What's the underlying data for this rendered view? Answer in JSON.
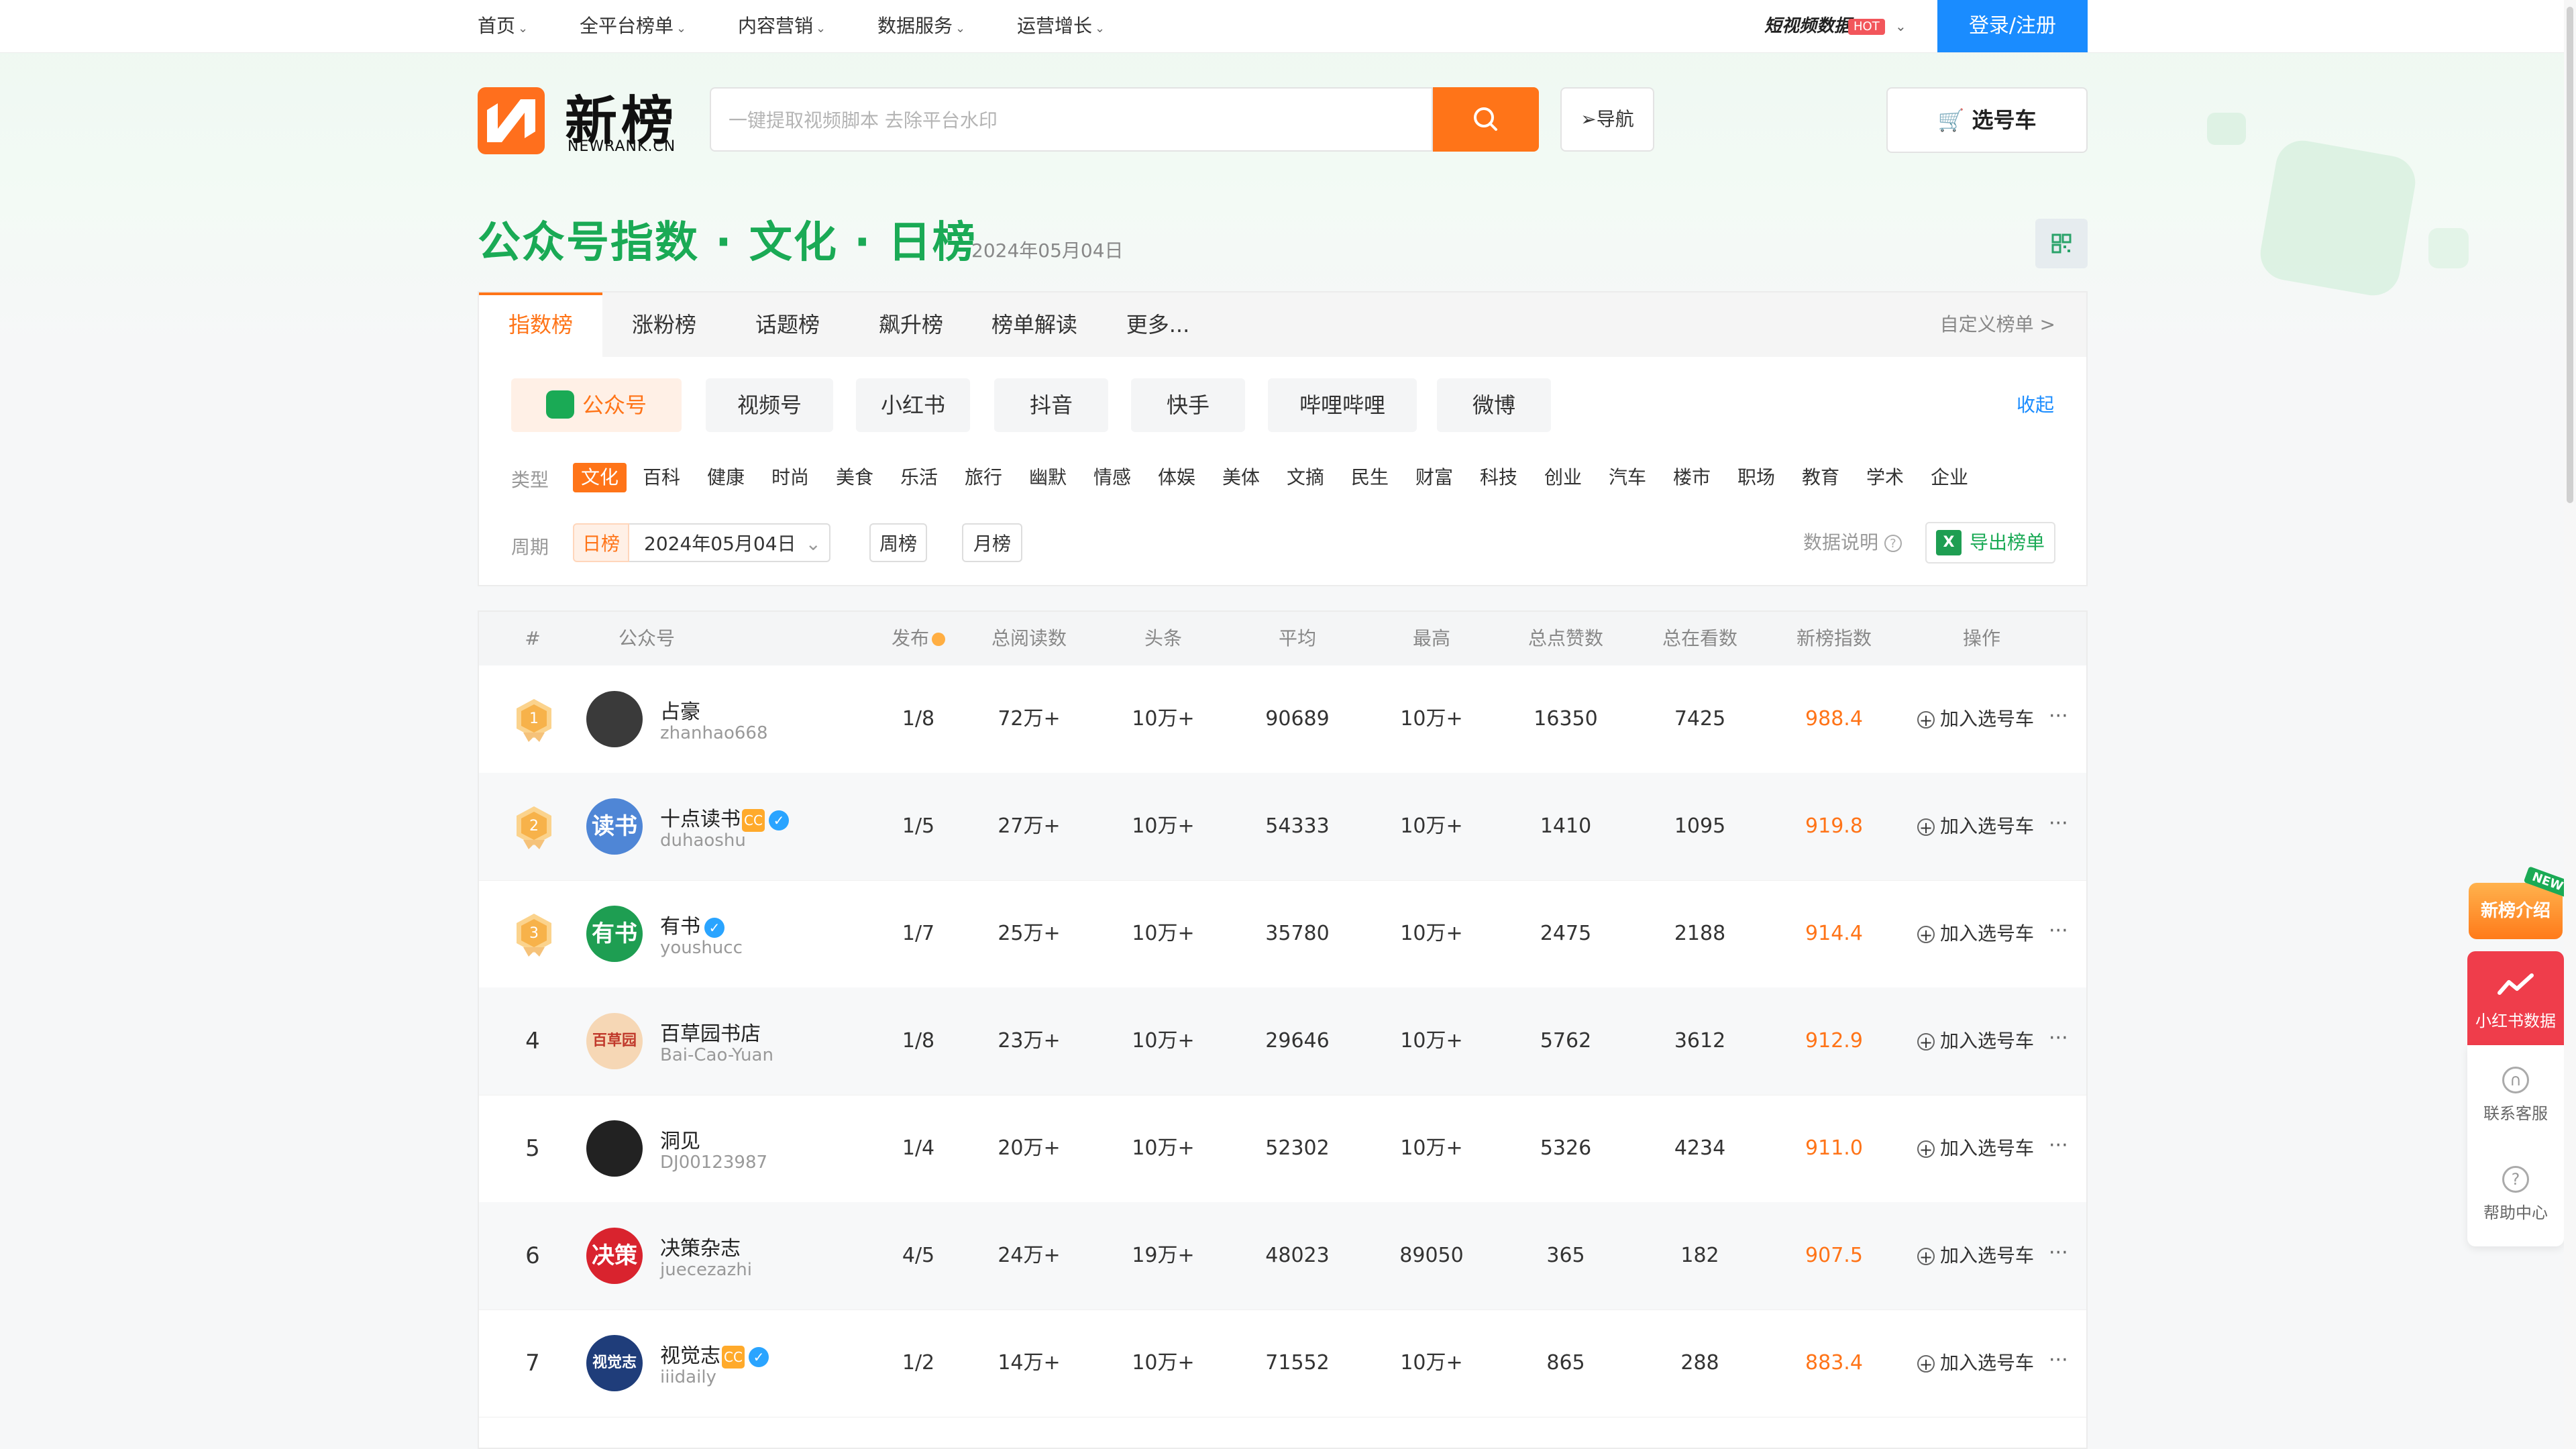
{
  "topnav": {
    "items": [
      {
        "label": "首页"
      },
      {
        "label": "全平台榜单"
      },
      {
        "label": "内容营销"
      },
      {
        "label": "数据服务"
      },
      {
        "label": "运营增长"
      }
    ],
    "video_data": "短视频数据",
    "hot_badge": "HOT",
    "login": "登录/注册"
  },
  "header": {
    "logo_text": "新榜",
    "logo_sub": "NEWRANK.CN",
    "search_placeholder": "一键提取视频脚本 去除平台水印",
    "nav_label": "导航",
    "cart_label": "选号车"
  },
  "title": {
    "main": "公众号指数 · 文化 · 日榜",
    "date": "2024年05月04日"
  },
  "tabs": [
    {
      "label": "指数榜",
      "active": true
    },
    {
      "label": "涨粉榜"
    },
    {
      "label": "话题榜"
    },
    {
      "label": "飙升榜"
    },
    {
      "label": "榜单解读"
    },
    {
      "label": "更多..."
    }
  ],
  "custom_list": "自定义榜单 >",
  "platforms": [
    {
      "label": "公众号",
      "active": true
    },
    {
      "label": "视频号"
    },
    {
      "label": "小红书"
    },
    {
      "label": "抖音"
    },
    {
      "label": "快手"
    },
    {
      "label": "哔哩哔哩"
    },
    {
      "label": "微博"
    }
  ],
  "collapse": "收起",
  "type_label": "类型",
  "categories": [
    "文化",
    "百科",
    "健康",
    "时尚",
    "美食",
    "乐活",
    "旅行",
    "幽默",
    "情感",
    "体娱",
    "美体",
    "文摘",
    "民生",
    "财富",
    "科技",
    "创业",
    "汽车",
    "楼市",
    "职场",
    "教育",
    "学术",
    "企业"
  ],
  "active_category": "文化",
  "period": {
    "label": "周期",
    "day": "日榜",
    "date_value": "2024年05月04日",
    "week": "周榜",
    "month": "月榜",
    "data_desc": "数据说明",
    "export": "导出榜单"
  },
  "table": {
    "headers": [
      "#",
      "公众号",
      "发布",
      "总阅读数",
      "头条",
      "平均",
      "最高",
      "总点赞数",
      "总在看数",
      "新榜指数",
      "操作"
    ],
    "rows": [
      {
        "rank": "1",
        "name": "占豪",
        "id": "zhanhao668",
        "pub": "1/8",
        "reads": "72万+",
        "top": "10万+",
        "avg": "90689",
        "max": "10万+",
        "likes": "16350",
        "watching": "7425",
        "index": "988.4",
        "cc": false,
        "verified": false,
        "avatar": "",
        "avatar_color": "#3a3a3a"
      },
      {
        "rank": "2",
        "name": "十点读书",
        "id": "duhaoshu",
        "pub": "1/5",
        "reads": "27万+",
        "top": "10万+",
        "avg": "54333",
        "max": "10万+",
        "likes": "1410",
        "watching": "1095",
        "index": "919.8",
        "cc": true,
        "verified": true,
        "avatar": "读书",
        "avatar_color": "#4f86d6"
      },
      {
        "rank": "3",
        "name": "有书",
        "id": "youshucc",
        "pub": "1/7",
        "reads": "25万+",
        "top": "10万+",
        "avg": "35780",
        "max": "10万+",
        "likes": "2475",
        "watching": "2188",
        "index": "914.4",
        "cc": false,
        "verified": true,
        "avatar": "有书",
        "avatar_color": "#1e9e52"
      },
      {
        "rank": "4",
        "name": "百草园书店",
        "id": "Bai-Cao-Yuan",
        "pub": "1/8",
        "reads": "23万+",
        "top": "10万+",
        "avg": "29646",
        "max": "10万+",
        "likes": "5762",
        "watching": "3612",
        "index": "912.9",
        "cc": false,
        "verified": false,
        "avatar": "百草园",
        "avatar_color": "#f6d7b5"
      },
      {
        "rank": "5",
        "name": "洞见",
        "id": "DJ00123987",
        "pub": "1/4",
        "reads": "20万+",
        "top": "10万+",
        "avg": "52302",
        "max": "10万+",
        "likes": "5326",
        "watching": "4234",
        "index": "911.0",
        "cc": false,
        "verified": false,
        "avatar": "",
        "avatar_color": "#222222"
      },
      {
        "rank": "6",
        "name": "决策杂志",
        "id": "juecezazhi",
        "pub": "4/5",
        "reads": "24万+",
        "top": "19万+",
        "avg": "48023",
        "max": "89050",
        "likes": "365",
        "watching": "182",
        "index": "907.5",
        "cc": false,
        "verified": false,
        "avatar": "决策",
        "avatar_color": "#d9232e"
      },
      {
        "rank": "7",
        "name": "视觉志",
        "id": "iiidaily",
        "pub": "1/2",
        "reads": "14万+",
        "top": "10万+",
        "avg": "71552",
        "max": "10万+",
        "likes": "865",
        "watching": "288",
        "index": "883.4",
        "cc": true,
        "verified": true,
        "avatar": "视觉志",
        "avatar_color": "#1f3d7a"
      }
    ],
    "add_label": "加入选号车",
    "more": "···"
  },
  "side": {
    "intro": "新榜介绍",
    "new_badge": "NEW",
    "xhs_data": "小红书数据",
    "contact": "联系客服",
    "help": "帮助中心"
  },
  "colors": {
    "accent_orange": "#ff7418",
    "title_green": "#1aaa55",
    "login_blue": "#1a8cff",
    "side_red": "#ef3d4b"
  }
}
